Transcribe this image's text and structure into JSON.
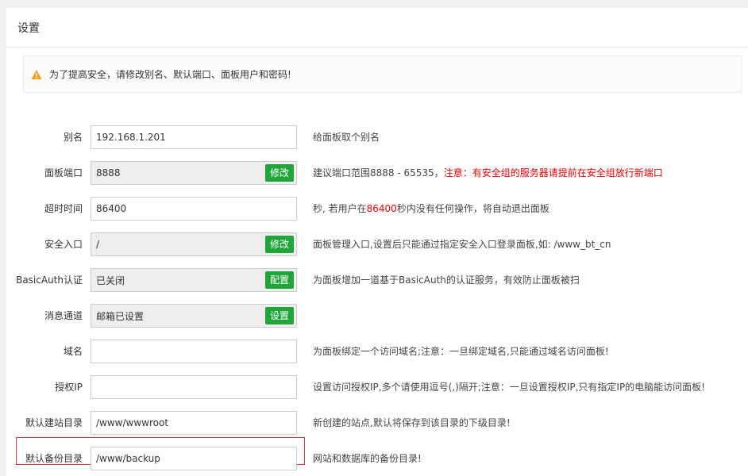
{
  "header": {
    "title": "设置"
  },
  "warning": {
    "text": "为了提高安全，请修改别名、默认端口、面板用户和密码!"
  },
  "accent_colors": {
    "button": "#20a53a",
    "warning_icon": "#f0a020",
    "alert_text": "#ee0000",
    "highlight_border": "#d43a3a"
  },
  "rows": [
    {
      "label": "别名",
      "value": "192.168.1.201",
      "hint": "给面板取个别名"
    },
    {
      "label": "面板端口",
      "value": "8888",
      "button": "修改",
      "hint_pre": "建议端口范围8888 - 65535，",
      "hint_red": "注意：有安全组的服务器请提前在安全组放行新端口"
    },
    {
      "label": "超时时间",
      "value": "86400",
      "hint_pre": "秒, 若用户在",
      "hint_red": "86400",
      "hint_post": "秒内没有任何操作，将自动退出面板"
    },
    {
      "label": "安全入口",
      "value": "/",
      "button": "修改",
      "hint": "面板管理入口,设置后只能通过指定安全入口登录面板,如: /www_bt_cn"
    },
    {
      "label": "BasicAuth认证",
      "value": "已关闭",
      "button": "配置",
      "hint": "为面板增加一道基于BasicAuth的认证服务，有效防止面板被扫"
    },
    {
      "label": "消息通道",
      "value": "邮箱已设置",
      "button": "设置"
    },
    {
      "label": "域名",
      "value": "",
      "hint": "为面板绑定一个访问域名;注意：一旦绑定域名,只能通过域名访问面板!"
    },
    {
      "label": "授权IP",
      "value": "",
      "hint": "设置访问授权IP,多个请使用逗号(,)隔开;注意：一旦设置授权IP,只有指定IP的电脑能访问面板!"
    },
    {
      "label": "默认建站目录",
      "value": "/www/wwwroot",
      "hint": "新创建的站点,默认将保存到该目录的下级目录!"
    },
    {
      "label": "默认备份目录",
      "value": "/www/backup",
      "hint": "网站和数据库的备份目录!"
    }
  ]
}
